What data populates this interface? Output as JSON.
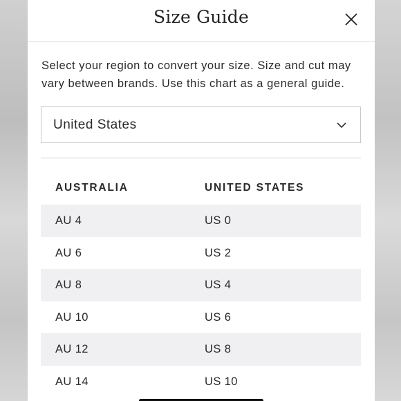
{
  "modal": {
    "title": "Size Guide",
    "close_icon": "close-icon",
    "intro": "Select your region to convert your size. Size and cut may vary between brands. Use this chart as a general guide."
  },
  "region_select": {
    "value": "United States",
    "icon": "chevron-down-icon"
  },
  "table": {
    "headers": [
      "AUSTRALIA",
      "UNITED STATES"
    ],
    "rows": [
      [
        "AU 4",
        "US 0"
      ],
      [
        "AU 6",
        "US 2"
      ],
      [
        "AU 8",
        "US 4"
      ],
      [
        "AU 10",
        "US 6"
      ],
      [
        "AU 12",
        "US 8"
      ],
      [
        "AU 14",
        "US 10"
      ]
    ],
    "row_shade_color": "#f0f0f2"
  }
}
